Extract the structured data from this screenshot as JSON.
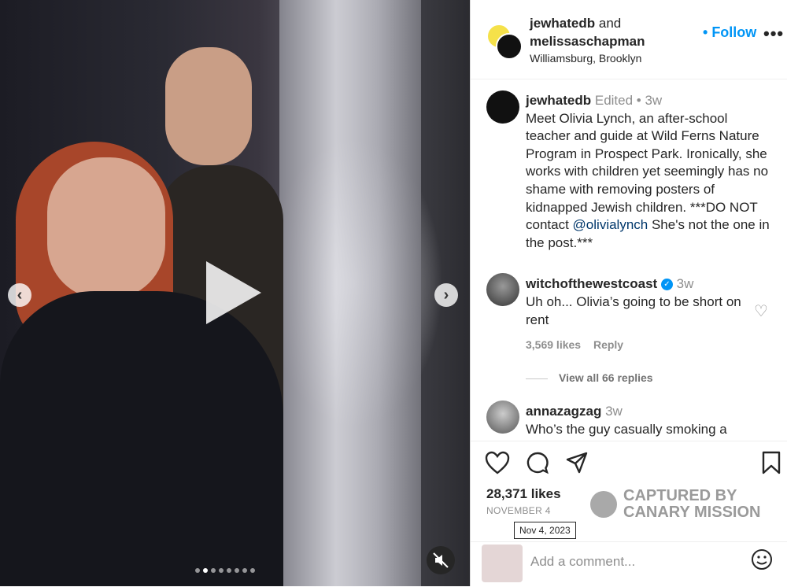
{
  "header": {
    "user1": "jewhatedb",
    "and_text": "and",
    "user2": "melissaschapman",
    "location": "Williamsburg, Brooklyn",
    "follow_label": "Follow",
    "more_label": "•••"
  },
  "caption": {
    "username": "jewhatedb",
    "edited": "Edited",
    "time": "3w",
    "text_before": "Meet Olivia Lynch, an after-school teacher and guide at Wild Ferns Nature Program in Prospect Park. Ironically, she works with children yet seemingly has no shame with removing posters of kidnapped Jewish children. ***DO NOT contact ",
    "mention": "@olivialynch",
    "text_after": " She's not the one in the post.***"
  },
  "comments": [
    {
      "username": "witchofthewestcoast",
      "time": "3w",
      "text": "Uh oh... Olivia’s going to be short on rent",
      "likes": "3,569 likes",
      "reply_label": "Reply",
      "view_replies": "View all 66 replies"
    },
    {
      "username": "annazagzag",
      "time": "3w",
      "text": "Who’s the guy casually smoking a"
    }
  ],
  "post": {
    "likes": "28,371 likes",
    "date": "NOVEMBER 4",
    "tooltip": "Nov 4, 2023",
    "comment_placeholder": "Add a comment..."
  },
  "watermark": {
    "line1": "CAPTURED BY",
    "line2": "CANARY MISSION"
  },
  "media": {
    "carousel_count": 8,
    "active_index": 1
  },
  "icons": [
    "heart-icon",
    "comment-icon",
    "share-icon",
    "bookmark-icon",
    "mute-icon",
    "emoji-icon",
    "play-icon",
    "chevron-left-icon",
    "chevron-right-icon"
  ]
}
